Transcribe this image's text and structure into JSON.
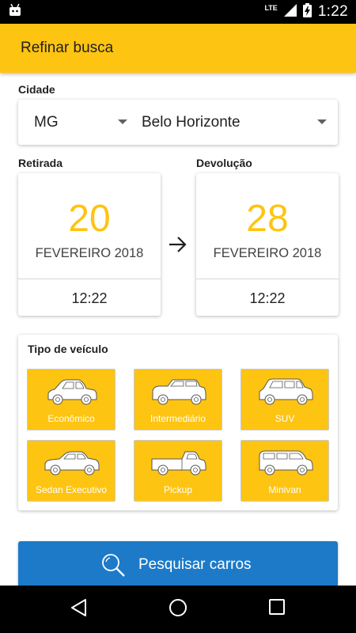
{
  "status_bar": {
    "network": "LTE",
    "time": "1:22"
  },
  "app_bar": {
    "title": "Refinar busca"
  },
  "city": {
    "label": "Cidade",
    "state_value": "MG",
    "city_value": "Belo Horizonte"
  },
  "pickup": {
    "label": "Retirada",
    "day": "20",
    "month_year": "FEVEREIRO 2018",
    "time": "12:22"
  },
  "return": {
    "label": "Devolução",
    "day": "28",
    "month_year": "FEVEREIRO 2018",
    "time": "12:22"
  },
  "vehicle_types": {
    "title": "Tipo de veículo",
    "items": [
      {
        "label": "Econômico",
        "icon": "economy-car-icon"
      },
      {
        "label": "Intermediário",
        "icon": "intermediate-car-icon"
      },
      {
        "label": "SUV",
        "icon": "suv-icon"
      },
      {
        "label": "Sedan Executivo",
        "icon": "sedan-icon"
      },
      {
        "label": "Pickup",
        "icon": "pickup-truck-icon"
      },
      {
        "label": "Minivan",
        "icon": "minivan-icon"
      }
    ]
  },
  "search_button": {
    "label": "Pesquisar carros",
    "icon": "search-icon"
  },
  "nav_bar": {
    "back_icon": "back-triangle-icon",
    "home_icon": "home-circle-icon",
    "recents_icon": "recents-square-icon"
  },
  "colors": {
    "accent": "#fec412",
    "primary_button": "#1c7ac8"
  }
}
